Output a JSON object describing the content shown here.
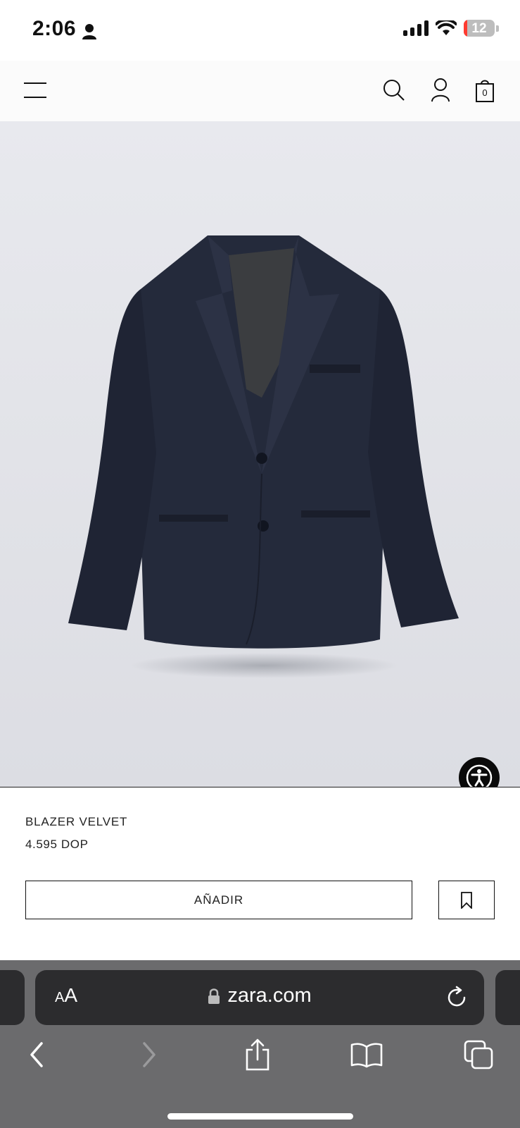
{
  "status_bar": {
    "time": "2:06",
    "battery_level": "12",
    "battery_fraction": 0.12,
    "battery_color": "#ff3b30"
  },
  "header": {
    "menu_icon": "hamburger-menu-icon",
    "search_icon": "search-icon",
    "account_icon": "account-icon",
    "bag_icon": "shopping-bag-icon",
    "bag_count": "0"
  },
  "product": {
    "image_description_icon": "blazer-product-image",
    "name": "BLAZER VELVET",
    "price": "4.595 DOP",
    "add_label": "AÑADIR",
    "save_icon": "bookmark-icon",
    "accessibility_icon": "accessibility-icon"
  },
  "browser": {
    "text_size_large": "A",
    "text_size_small": "A",
    "url": "zara.com",
    "lock_icon": "lock-icon",
    "reload_icon": "reload-icon",
    "nav": {
      "back_icon": "back-icon",
      "forward_icon": "forward-icon",
      "share_icon": "share-icon",
      "bookmarks_icon": "bookmarks-icon",
      "tabs_icon": "tabs-icon"
    }
  }
}
